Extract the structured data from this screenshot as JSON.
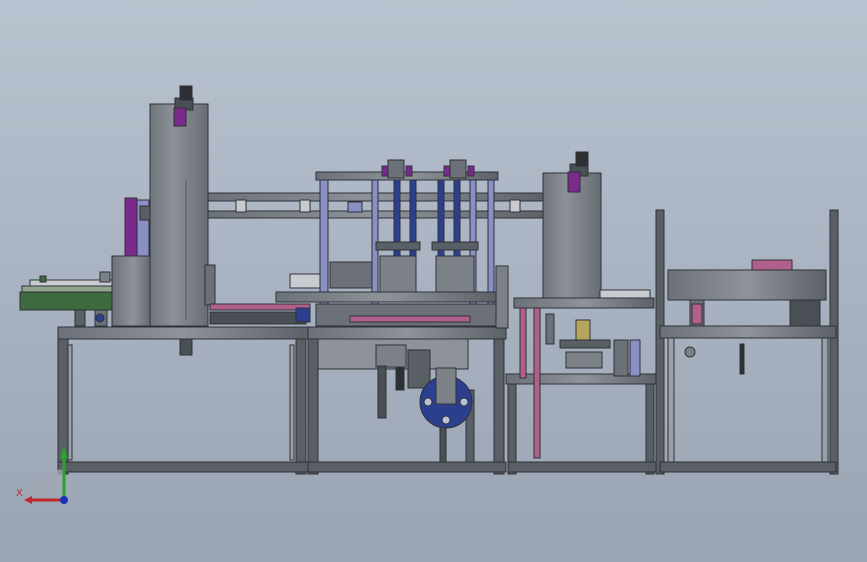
{
  "window": {
    "title": "",
    "background_colors": [
      "#b9c3d0",
      "#9aa4b2"
    ]
  },
  "triad": {
    "x_label": "X",
    "y_label": "Y",
    "x_color": "#c0262b",
    "y_color": "#2aa52a",
    "z_color": "#1b2fb8"
  },
  "machine": {
    "frame_color": "#5a5f66",
    "accent_colors": {
      "motor": "#7a2a8a",
      "rod": "#8a8fc4",
      "pink_rod": "#b0608a",
      "blue_wheel": "#2c3f8f",
      "green_belt": "#3d6b3d"
    }
  }
}
